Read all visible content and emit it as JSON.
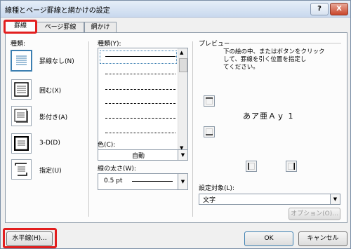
{
  "window": {
    "title": "線種とページ罫線と網かけの設定",
    "help_label": "?",
    "close_label": "X"
  },
  "tabs": [
    {
      "label": "罫線"
    },
    {
      "label": "ページ罫線"
    },
    {
      "label": "網かけ"
    }
  ],
  "setting": {
    "label": "種類:",
    "presets": [
      {
        "label": "罫線なし(N)"
      },
      {
        "label": "囲む(X)"
      },
      {
        "label": "影付き(A)"
      },
      {
        "label": "3-D(D)"
      },
      {
        "label": "指定(U)"
      }
    ]
  },
  "style": {
    "label": "種類(Y):"
  },
  "color": {
    "label": "色(C):",
    "value": "自動"
  },
  "width": {
    "label": "線の太さ(W):",
    "value": "0.5 pt"
  },
  "preview": {
    "label": "プレビュー",
    "instructions": [
      "下の絵の中、またはボタンをクリック",
      "して、罫線を引く位置を指定し",
      "てください。"
    ],
    "sample_text": "あア亜Ａｙ 1"
  },
  "apply_to": {
    "label": "設定対象(L):",
    "value": "文字"
  },
  "options_button": "オプション(O)...",
  "footer": {
    "horizontal_line": "水平線(H)...",
    "ok": "OK",
    "cancel": "キャンセル"
  },
  "colors": {
    "highlight_red": "#e21e1e",
    "selected_blue": "#3c7fb1"
  }
}
